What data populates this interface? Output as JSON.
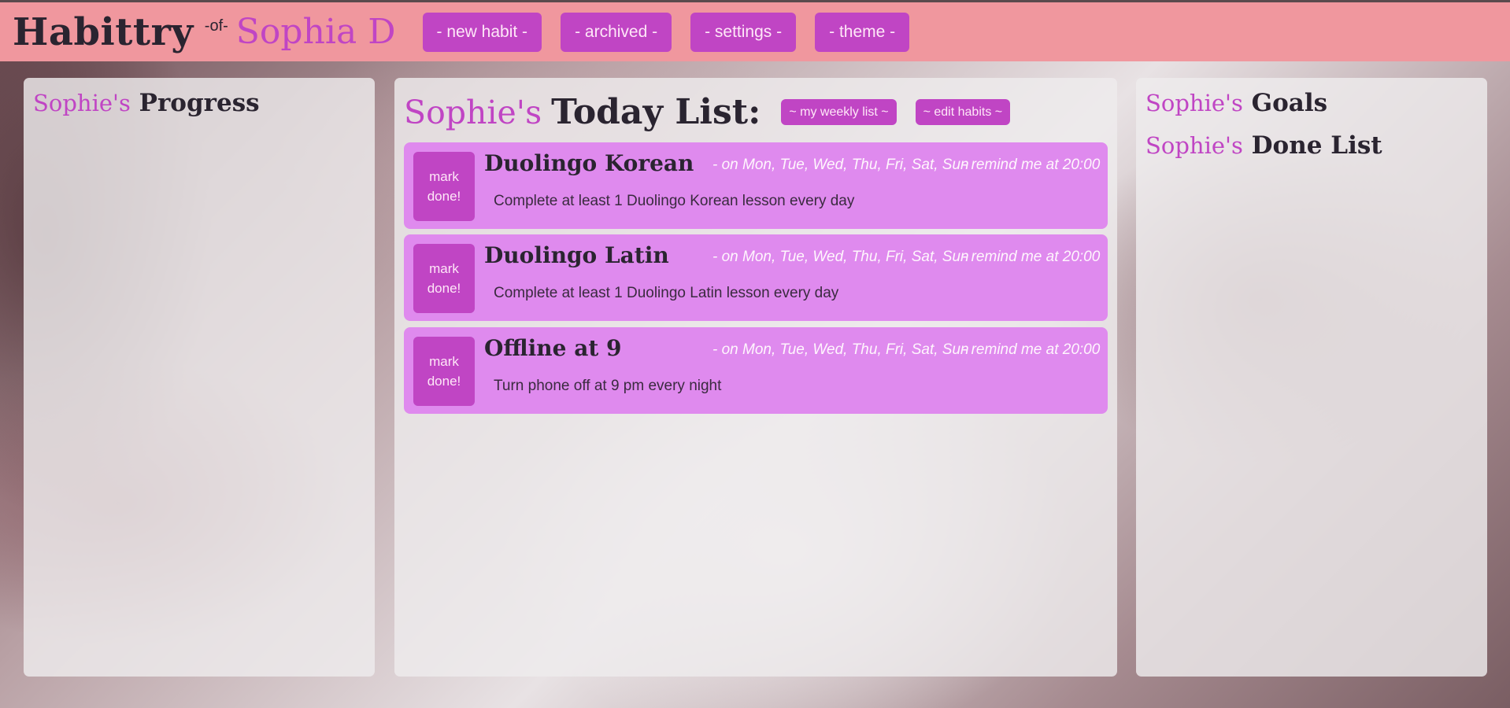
{
  "app": {
    "brand": "Habittry",
    "of_label": "-of-",
    "user_display": "Sophia D"
  },
  "nav": {
    "new_habit": "- new habit -",
    "archived": "- archived -",
    "settings": "- settings -",
    "theme": "- theme -"
  },
  "owner": "Sophie's",
  "progress": {
    "title": "Progress"
  },
  "today": {
    "title": "Today List:",
    "weekly_button": "~ my weekly list ~",
    "edit_button": "~ edit habits ~",
    "habits": [
      {
        "mark_line1": "mark",
        "mark_line2": "done!",
        "name": "Duolingo Korean",
        "days": "- on Mon, Tue, Wed, Thu, Fri, Sat, Sun",
        "remind": "- remind me at 20:00",
        "description": "Complete at least 1 Duolingo Korean lesson every day"
      },
      {
        "mark_line1": "mark",
        "mark_line2": "done!",
        "name": "Duolingo Latin",
        "days": "- on Mon, Tue, Wed, Thu, Fri, Sat, Sun",
        "remind": "- remind me at 20:00",
        "description": "Complete at least 1 Duolingo Latin lesson every day"
      },
      {
        "mark_line1": "mark",
        "mark_line2": "done!",
        "name": "Offline at 9",
        "days": "- on Mon, Tue, Wed, Thu, Fri, Sat, Sun",
        "remind": "- remind me at 20:00",
        "description": "Turn phone off at 9 pm every night"
      }
    ]
  },
  "goals": {
    "title": "Goals"
  },
  "done_list": {
    "title": "Done List"
  },
  "colors": {
    "header_bg": "#f0979e",
    "accent": "#c045c4",
    "habit_card": "#df8aee",
    "panel_bg": "#eeebed"
  }
}
